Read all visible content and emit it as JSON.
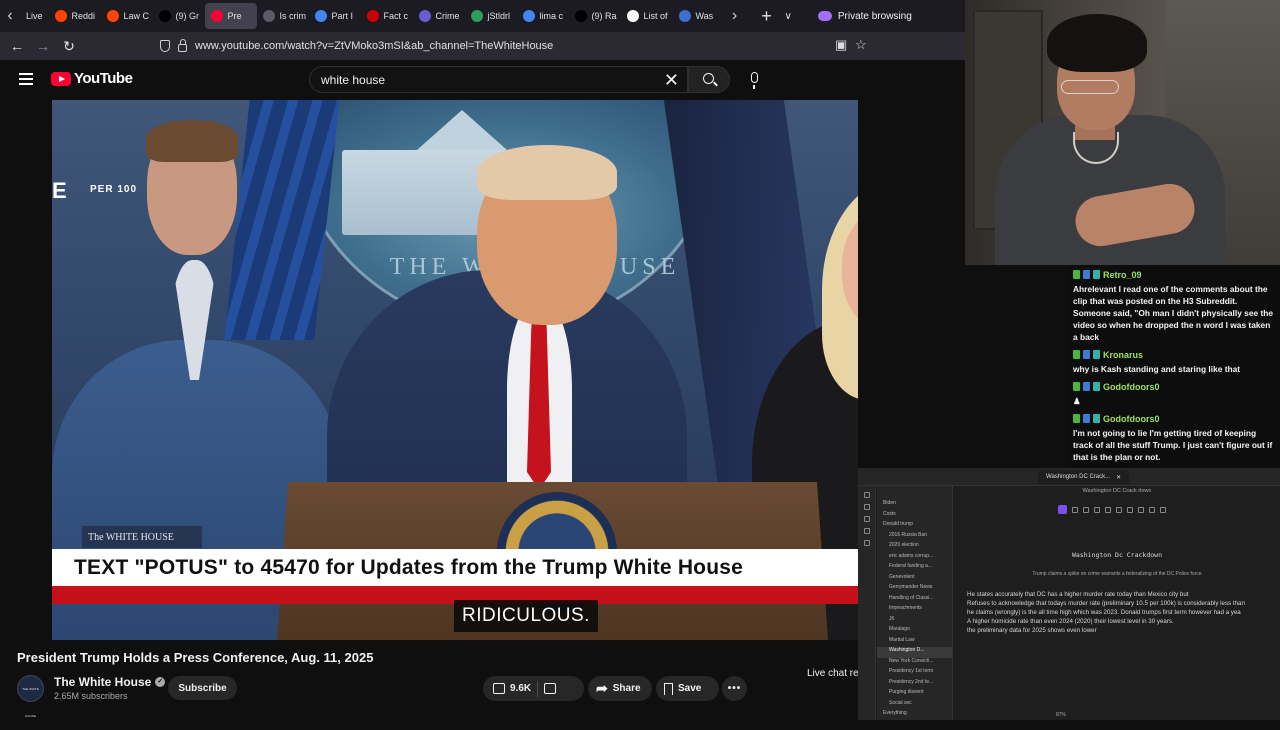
{
  "browser": {
    "tabs": [
      {
        "label": "Live",
        "icon": "chevron-left-icon",
        "color": "#1c1b22"
      },
      {
        "label": "Reddi",
        "icon": "reddit-icon",
        "color": "#ff4500"
      },
      {
        "label": "Law C",
        "icon": "reddit-icon",
        "color": "#ff4500"
      },
      {
        "label": "(9) Gr",
        "icon": "x-icon",
        "color": "#000000"
      },
      {
        "label": "Pre",
        "icon": "youtube-icon",
        "color": "#ff0033"
      },
      {
        "label": "Is crim",
        "icon": "page-icon",
        "color": "#5a5a66"
      },
      {
        "label": "Part I",
        "icon": "google-icon",
        "color": "#4285f4"
      },
      {
        "label": "Fact c",
        "icon": "cnn-icon",
        "color": "#cc0000"
      },
      {
        "label": "Crime",
        "icon": "crime-icon",
        "color": "#6b5bd6"
      },
      {
        "label": "jStldrl",
        "icon": "site-icon",
        "color": "#2f9e5b"
      },
      {
        "label": "lima c",
        "icon": "google-icon",
        "color": "#4285f4"
      },
      {
        "label": "(9) Ra",
        "icon": "x-icon",
        "color": "#000000"
      },
      {
        "label": "List of",
        "icon": "wikipedia-icon",
        "color": "#ffffff"
      },
      {
        "label": "Was",
        "icon": "site-icon",
        "color": "#3b6fd1"
      }
    ],
    "active_tab_index": 4,
    "private_label": "Private browsing",
    "url": "www.youtube.com/watch?v=ZtVMoko3mSI&ab_channel=TheWhiteHouse"
  },
  "youtube": {
    "logo_text": "YouTube",
    "search_value": "white house",
    "video": {
      "per_text": "PER 100",
      "badge_text": "The WHITE HOUSE",
      "backdrop_text": "THE WHITE HOUSE",
      "podium_text": "PRESIDENT OF THE UNITED STATES",
      "lower_third": "TEXT \"POTUS\" to 45470 for Updates from the Trump White House",
      "caption": "RIDICULOUS."
    },
    "title": "President Trump Holds a Press Conference, Aug. 11, 2025",
    "channel": {
      "name": "The White House",
      "subscribers": "2.65M subscribers",
      "avatar_text": "THE WHITE HOUSE"
    },
    "subscribe_label": "Subscribe",
    "like_count": "9.6K",
    "share_label": "Share",
    "save_label": "Save",
    "more_label": "•••",
    "live_chat_label": "Live chat re"
  },
  "chat": {
    "messages": [
      {
        "user": "Retro_09",
        "text": "Ahrelevant I read one of the comments about the clip that was posted on the H3 Subreddit. Someone said, \"Oh man I didn't physically see the video so when he dropped the n word I was taken a back"
      },
      {
        "user": "Kronarus",
        "text": "why is Kash standing and staring like that"
      },
      {
        "user": "Godofdoors0",
        "text": "♟"
      },
      {
        "user": "Godofdoors0",
        "text": "I'm not going to lie I'm getting tired of keeping track of all the stuff Trump. I just can't figure out if that is the plan or not."
      },
      {
        "user": "Godofdoors0",
        "text": ""
      }
    ]
  },
  "notes": {
    "tab_label": "Washington DC Crack...",
    "breadcrumb": "Washington DC Crack down",
    "sidebar": [
      {
        "label": "Biden",
        "folder": true
      },
      {
        "label": "Costs",
        "folder": true
      },
      {
        "label": "Donald trump",
        "folder": true
      },
      {
        "label": "2016 Russia Ban",
        "folder": false
      },
      {
        "label": "2020 election",
        "folder": false
      },
      {
        "label": "eric adams corrup...",
        "folder": false
      },
      {
        "label": "Federal funding a...",
        "folder": false
      },
      {
        "label": "Genevolent",
        "folder": false
      },
      {
        "label": "Gerrymander News",
        "folder": false
      },
      {
        "label": "Handling of Classi...",
        "folder": false
      },
      {
        "label": "Impeachments",
        "folder": false
      },
      {
        "label": "J6",
        "folder": false
      },
      {
        "label": "Maralago",
        "folder": false
      },
      {
        "label": "Martial Law",
        "folder": false
      },
      {
        "label": "Washington D...",
        "folder": false
      },
      {
        "label": "New York Convicti...",
        "folder": false
      },
      {
        "label": "Presidency 1st term",
        "folder": false
      },
      {
        "label": "Presidency 2nd te...",
        "folder": false
      },
      {
        "label": "Purging dissent",
        "folder": false
      },
      {
        "label": "Social sec",
        "folder": false
      },
      {
        "label": "Everything",
        "folder": true
      }
    ],
    "active_sidebar_index": 14,
    "title": "Washington Dc Crackdown",
    "subtitle": "Trump claims a spike on crime warrants a federalizing of the DC Police force",
    "body": [
      "He states accurately that DC has a higher murder rate today than Mexico city but",
      "Refuses to acknowledge that todays murder rate (preliminary 10.5 per 100k) is considerably less than",
      "he claims (wrongly) is the all time high which was 2023. Donald trumps first term however had a yea",
      "A higher homicide rate than even 2024 (2020) their lowest level in 30 years.",
      "the preliminary data for 2025 shows even lower"
    ],
    "zoom": "87%"
  },
  "colors": {
    "accent_red": "#c5101a",
    "yt_red": "#ff0033",
    "chat_username": "#9be35f",
    "obsidian_accent": "#7a52e8"
  }
}
